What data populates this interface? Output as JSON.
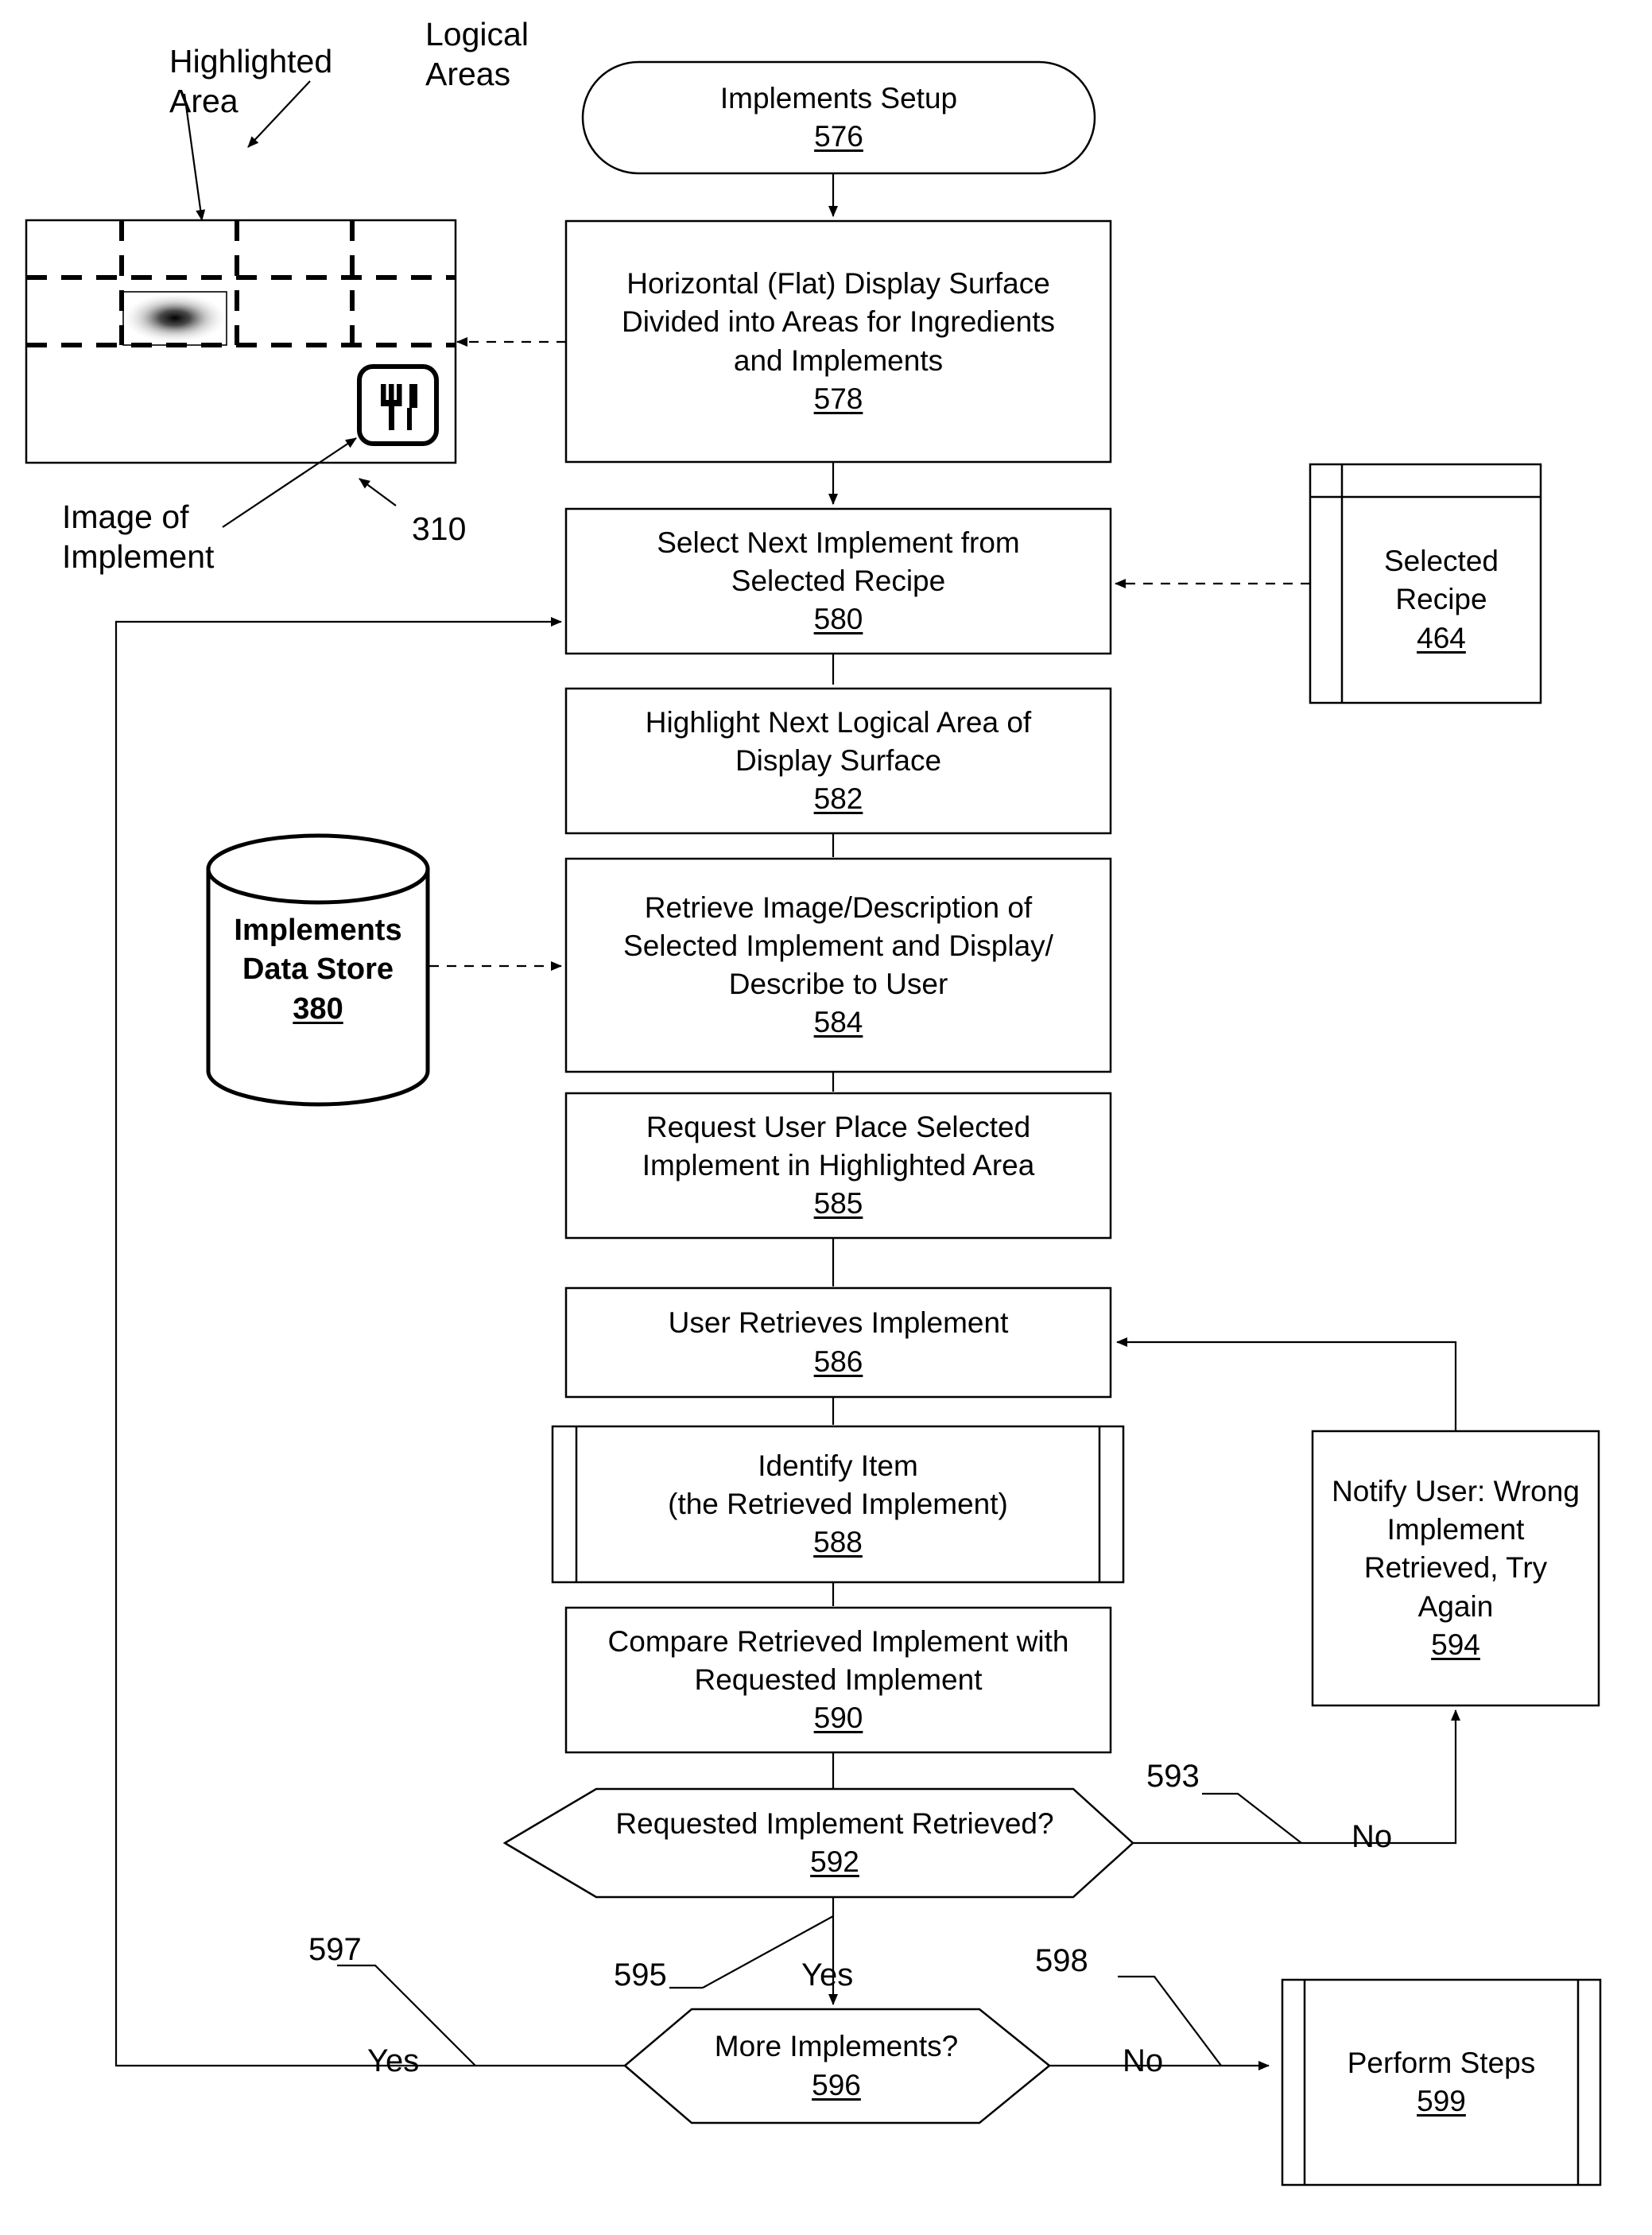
{
  "figure": {
    "type": "patent-flowchart",
    "title_node": {
      "label": "Implements Setup",
      "ref": "576"
    },
    "callouts": [
      {
        "id": "highlighted-area",
        "text": "Highlighted\nArea"
      },
      {
        "id": "logical-areas",
        "text": "Logical\nAreas"
      },
      {
        "id": "image-of-implement",
        "text": "Image of\nImplement"
      },
      {
        "id": "display-surface-ref",
        "text": "310"
      }
    ],
    "nodes": [
      {
        "id": "n576",
        "shape": "stadium",
        "label": "Implements Setup",
        "ref": "576"
      },
      {
        "id": "n578",
        "shape": "process",
        "label": "Horizontal (Flat) Display Surface Divided into Areas for Ingredients and Implements",
        "lines": [
          "Horizontal (Flat) Display Surface",
          "Divided into Areas for Ingredients",
          "and Implements"
        ],
        "ref": "578"
      },
      {
        "id": "n580",
        "shape": "process",
        "label": "Select Next Implement from Selected Recipe",
        "lines": [
          "Select Next Implement from",
          "Selected Recipe"
        ],
        "ref": "580"
      },
      {
        "id": "n582",
        "shape": "process",
        "label": "Highlight Next Logical Area of Display Surface",
        "lines": [
          "Highlight Next Logical Area of",
          "Display Surface"
        ],
        "ref": "582"
      },
      {
        "id": "n584",
        "shape": "process",
        "label": "Retrieve Image/Description of Selected Implement and Display/ Describe to User",
        "lines": [
          "Retrieve Image/Description of",
          "Selected Implement and Display/",
          "Describe to User"
        ],
        "ref": "584"
      },
      {
        "id": "n585",
        "shape": "process",
        "label": "Request User Place Selected Implement in Highlighted Area",
        "lines": [
          "Request User Place Selected",
          "Implement in Highlighted Area"
        ],
        "ref": "585"
      },
      {
        "id": "n586",
        "shape": "process",
        "label": "User Retrieves Implement",
        "lines": [
          "User Retrieves Implement"
        ],
        "ref": "586"
      },
      {
        "id": "n588",
        "shape": "predefined-process",
        "label": "Identify Item (the Retrieved Implement)",
        "lines": [
          "Identify Item",
          "(the Retrieved Implement)"
        ],
        "ref": "588"
      },
      {
        "id": "n590",
        "shape": "process",
        "label": "Compare Retrieved Implement with Requested Implement",
        "lines": [
          "Compare Retrieved Implement with",
          "Requested Implement"
        ],
        "ref": "590"
      },
      {
        "id": "n592",
        "shape": "decision",
        "label": "Requested Implement Retrieved?",
        "lines": [
          "Requested Implement Retrieved?"
        ],
        "ref": "592"
      },
      {
        "id": "n594",
        "shape": "process",
        "label": "Notify User: Wrong Implement Retrieved, Try Again",
        "lines": [
          "Notify User: Wrong",
          "Implement",
          "Retrieved, Try",
          "Again"
        ],
        "ref": "594"
      },
      {
        "id": "n596",
        "shape": "decision",
        "label": "More Implements?",
        "lines": [
          "More Implements?"
        ],
        "ref": "596"
      },
      {
        "id": "n599",
        "shape": "predefined-process",
        "label": "Perform Steps",
        "lines": [
          "Perform Steps"
        ],
        "ref": "599"
      },
      {
        "id": "n464",
        "shape": "document",
        "label": "Selected Recipe",
        "lines": [
          "Selected",
          "Recipe"
        ],
        "ref": "464"
      },
      {
        "id": "n380",
        "shape": "cylinder",
        "label": "Implements Data Store",
        "lines": [
          "Implements",
          "Data Store"
        ],
        "ref": "380"
      }
    ],
    "edge_labels": [
      {
        "id": "edge-593",
        "text": "593"
      },
      {
        "id": "edge-no-593",
        "text": "No"
      },
      {
        "id": "edge-595",
        "text": "595"
      },
      {
        "id": "edge-yes-595",
        "text": "Yes"
      },
      {
        "id": "edge-597",
        "text": "597"
      },
      {
        "id": "edge-yes-597",
        "text": "Yes"
      },
      {
        "id": "edge-598",
        "text": "598"
      },
      {
        "id": "edge-no-598",
        "text": "No"
      }
    ],
    "display_surface": {
      "ref": "310",
      "highlighted_area_label": "Highlighted Area",
      "logical_areas_label": "Logical Areas",
      "implement_icon": "fork-and-knife-icon"
    }
  },
  "colors": {
    "stroke": "#000000",
    "background": "#ffffff",
    "text": "#000000"
  }
}
